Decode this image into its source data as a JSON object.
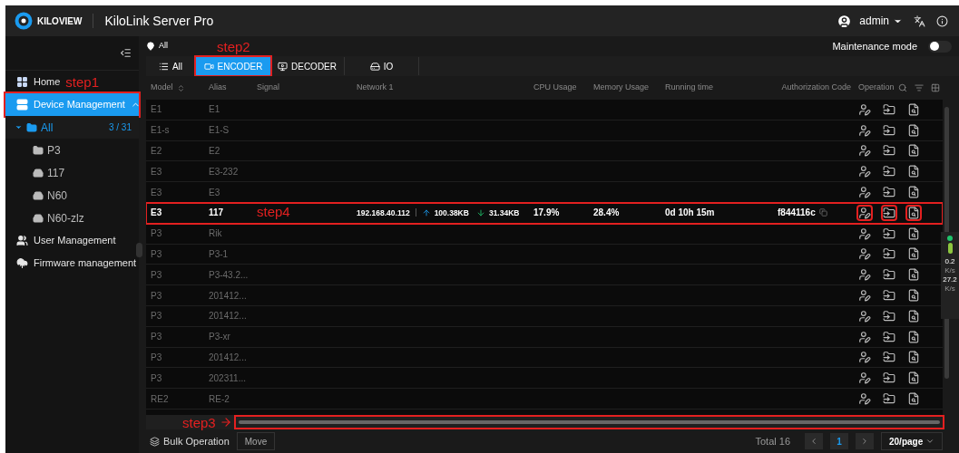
{
  "header": {
    "logo": "KILOVIEW",
    "title": "KiloLink Server Pro",
    "user": "admin"
  },
  "sidebar": {
    "items": [
      {
        "label": "Home",
        "kind": "home",
        "selected": false,
        "annotated": false,
        "step": "step1"
      },
      {
        "label": "Device Management",
        "kind": "devices",
        "selected": true,
        "expanded": true,
        "annotated": true,
        "children": [
          {
            "label": "All",
            "kind": "folder",
            "count": "3 / 31",
            "selected": true,
            "expanded": true,
            "children": [
              {
                "label": "P3",
                "kind": "folder",
                "selected": false
              },
              {
                "label": "117",
                "kind": "device",
                "selected": false
              },
              {
                "label": "N60",
                "kind": "device",
                "selected": false
              },
              {
                "label": "N60-zlz",
                "kind": "device",
                "selected": false
              }
            ]
          }
        ]
      },
      {
        "label": "User Management",
        "kind": "users",
        "selected": false,
        "annotated": false
      },
      {
        "label": "Firmware management",
        "kind": "firmware",
        "selected": false,
        "annotated": false
      }
    ]
  },
  "location": "All",
  "step2": "step2",
  "maintenance": {
    "label": "Maintenance mode",
    "on": false
  },
  "tabs": [
    {
      "label": "All",
      "kind": "all",
      "selected": false,
      "annotated": false
    },
    {
      "label": "ENCODER",
      "kind": "encoder",
      "selected": true,
      "annotated": true
    },
    {
      "label": "DECODER",
      "kind": "decoder",
      "selected": false,
      "annotated": false
    },
    {
      "label": "IO",
      "kind": "io",
      "selected": false,
      "annotated": false
    }
  ],
  "table": {
    "columns": [
      "Model",
      "Alias",
      "Signal",
      "Network 1",
      "CPU Usage",
      "Memory Usage",
      "Running time",
      "Authorization Code",
      "Operation"
    ],
    "rows": [
      {
        "model": "E1",
        "alias": "E1",
        "online": false,
        "annotated": false
      },
      {
        "model": "E1-s",
        "alias": "E1-S",
        "online": false,
        "annotated": false
      },
      {
        "model": "E2",
        "alias": "E2",
        "online": false,
        "annotated": false
      },
      {
        "model": "E3",
        "alias": "E3-232",
        "online": false,
        "annotated": false
      },
      {
        "model": "E3",
        "alias": "E3",
        "online": false,
        "annotated": false
      },
      {
        "model": "E3",
        "alias": "117",
        "online": true,
        "annotated": true,
        "step": "step4",
        "ip": "192.168.40.112",
        "up": "100.38KB",
        "down": "31.34KB",
        "cpu": "17.9%",
        "memory": "28.4%",
        "running": "0d 10h 15m",
        "auth": "f844116c"
      },
      {
        "model": "P3",
        "alias": "Rik",
        "online": false,
        "annotated": false
      },
      {
        "model": "P3",
        "alias": "P3-1",
        "online": false,
        "annotated": false
      },
      {
        "model": "P3",
        "alias": "P3-43.2...",
        "online": false,
        "annotated": false
      },
      {
        "model": "P3",
        "alias": "201412...",
        "online": false,
        "annotated": false
      },
      {
        "model": "P3",
        "alias": "201412...",
        "online": false,
        "annotated": false
      },
      {
        "model": "P3",
        "alias": "P3-xr",
        "online": false,
        "annotated": false
      },
      {
        "model": "P3",
        "alias": "201412...",
        "online": false,
        "annotated": false
      },
      {
        "model": "P3",
        "alias": "202311...",
        "online": false,
        "annotated": false
      },
      {
        "model": "RE2",
        "alias": "RE-2",
        "online": false,
        "annotated": false
      }
    ]
  },
  "scrollbar": {
    "annotated": true,
    "step": "step3"
  },
  "footer": {
    "bulk": "Bulk Operation",
    "move": "Move",
    "total": "Total 16",
    "pages": [
      {
        "label": "1",
        "selected": true
      }
    ],
    "page_size": "20/page"
  },
  "speed_widget": {
    "up": "0.2",
    "up_unit": "K/s",
    "down": "27.2",
    "down_unit": "K/s"
  }
}
